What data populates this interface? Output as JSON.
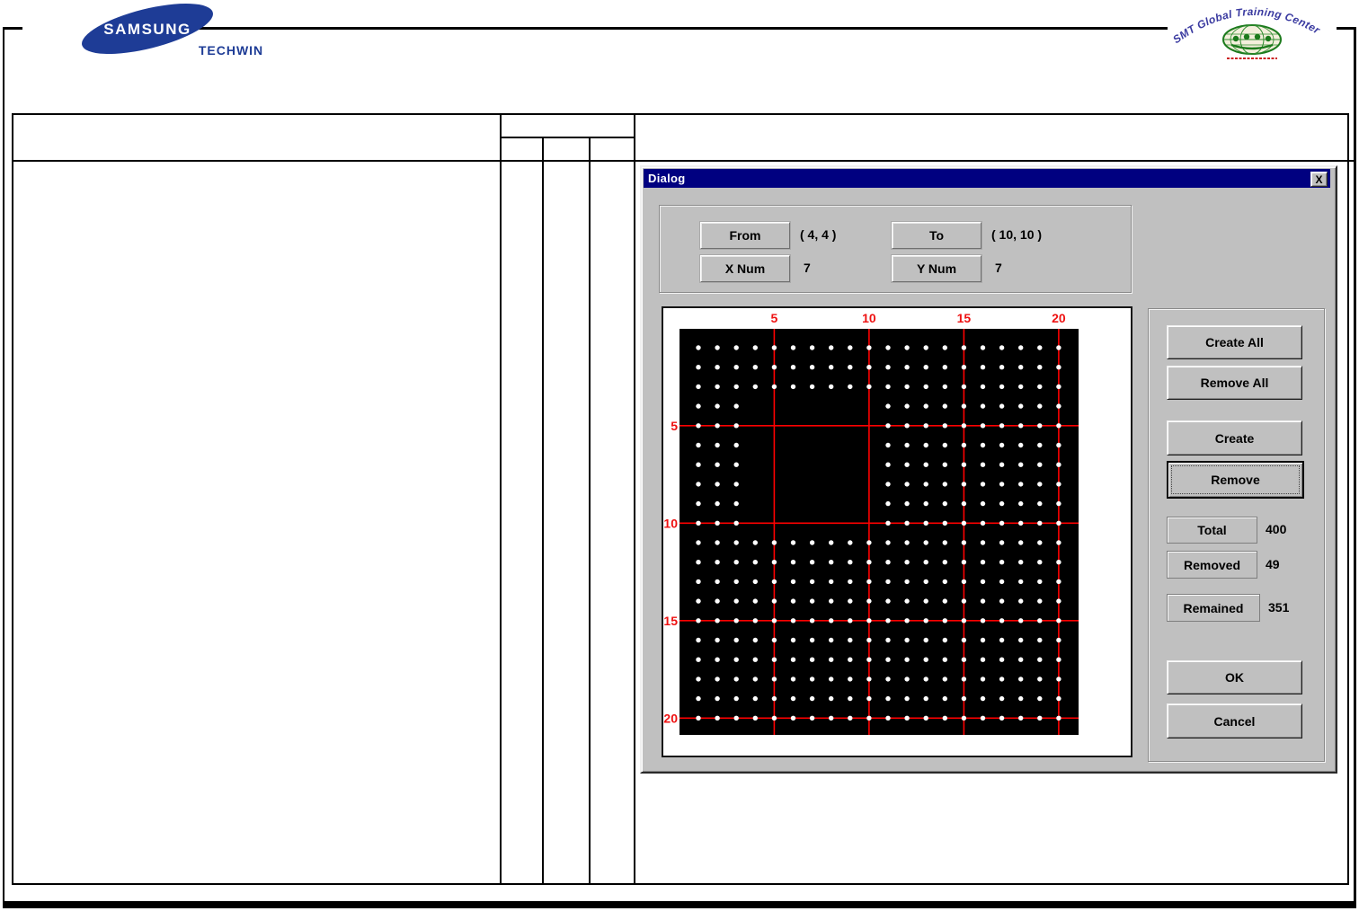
{
  "header": {
    "samsung_brand": "SAMSUNG",
    "samsung_sub": "TECHWIN",
    "smt_arc": "SMT Global Training Center"
  },
  "dialog": {
    "title": "Dialog",
    "close": "X",
    "params": {
      "from_label": "From",
      "from_value": "( 4, 4 )",
      "to_label": "To",
      "to_value": "( 10, 10 )",
      "xnum_label": "X Num",
      "xnum_value": "7",
      "ynum_label": "Y Num",
      "ynum_value": "7"
    },
    "buttons": {
      "create_all": "Create All",
      "remove_all": "Remove All",
      "create": "Create",
      "remove": "Remove",
      "ok": "OK",
      "cancel": "Cancel"
    },
    "stats": {
      "total_label": "Total",
      "total_value": "400",
      "removed_label": "Removed",
      "removed_value": "49",
      "remained_label": "Remained",
      "remained_value": "351"
    },
    "grid": {
      "cols": 20,
      "rows": 20,
      "tick_interval": 5,
      "tick_labels": [
        "5",
        "10",
        "15",
        "20"
      ],
      "removed_from": [
        4,
        4
      ],
      "removed_to": [
        10,
        10
      ],
      "colors": {
        "plot_bg": "#000000",
        "grid_line": "#ff0000",
        "tick_text": "#ee1111",
        "dot": "#ffffff",
        "canvas_bg": "#ffffff"
      }
    }
  },
  "colors": {
    "titlebar": "#000080",
    "dialog_bg": "#c0c0c0",
    "logo_blue": "#1e3c96",
    "smt_text": "#3a3aa0",
    "globe_green": "#1c7a1c",
    "tagline_red": "#cc2222"
  }
}
